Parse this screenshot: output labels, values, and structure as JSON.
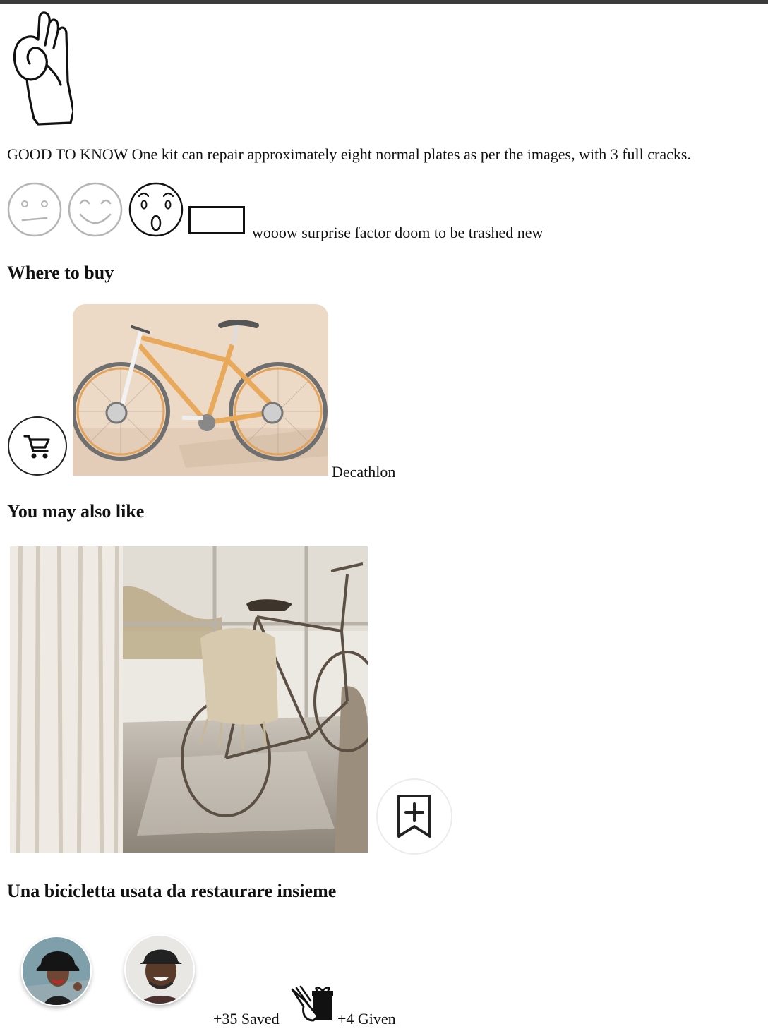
{
  "icons": {
    "ok_hand": "ok-hand-icon",
    "cart": "shopping-cart-icon",
    "save": "bookmark-add-icon",
    "gift": "gift-icon",
    "faces": [
      "neutral-face-icon",
      "smile-face-icon",
      "surprised-face-icon"
    ]
  },
  "tip": {
    "text": "GOOD TO KNOW One kit can repair approximately eight normal plates as per the images, with 3 full cracks."
  },
  "reaction": {
    "selected": "surprised",
    "input_value": "",
    "comment": "wooow surprise factor doom to be trashed new"
  },
  "where_to_buy": {
    "heading": "Where to buy",
    "store_name": "Decathlon"
  },
  "also_like": {
    "heading": "You may also like"
  },
  "featured": {
    "title": "Una bicicletta usata da restaurare insieme",
    "saved": "+35 Saved",
    "given": "+4 Given"
  },
  "colors": {
    "bike_frame": "#e8a95a",
    "bike_bg": "#ecd9c6",
    "photo_bg": "#d9cfc1",
    "faded_icon": "#b5b5b5"
  }
}
